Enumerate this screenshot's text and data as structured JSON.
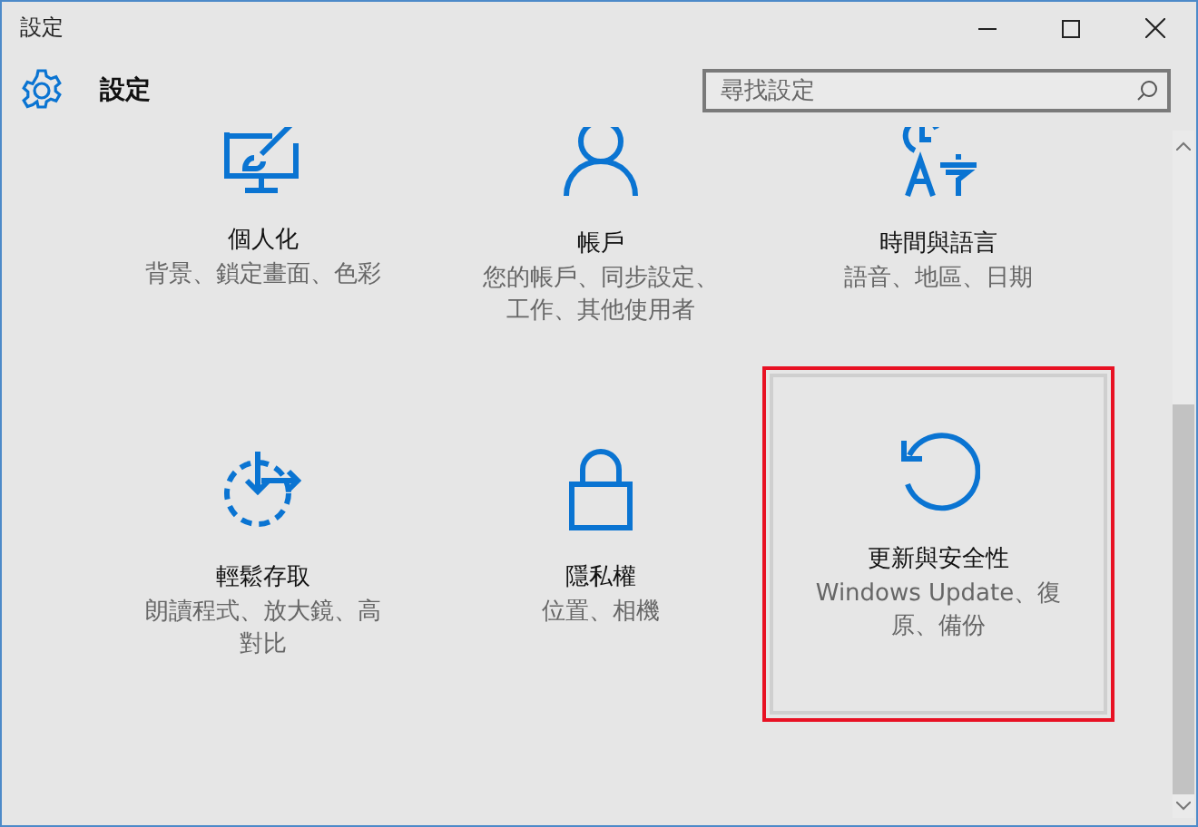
{
  "window": {
    "title": "設定"
  },
  "header": {
    "title": "設定"
  },
  "search": {
    "placeholder": "尋找設定"
  },
  "tiles": [
    {
      "kind": "personalization",
      "title": "個人化",
      "subtitle": "背景、鎖定畫面、色彩",
      "highlighted": false
    },
    {
      "kind": "accounts",
      "title": "帳戶",
      "subtitle": "您的帳戶、同步設定、工作、其他使用者",
      "highlighted": false
    },
    {
      "kind": "time-language",
      "title": "時間與語言",
      "subtitle": "語音、地區、日期",
      "highlighted": false
    },
    {
      "kind": "ease-of-access",
      "title": "輕鬆存取",
      "subtitle": "朗讀程式、放大鏡、高對比",
      "highlighted": false
    },
    {
      "kind": "privacy",
      "title": "隱私權",
      "subtitle": "位置、相機",
      "highlighted": false
    },
    {
      "kind": "update",
      "title": "更新與安全性",
      "subtitle": "Windows Update、復原、備份",
      "highlighted": true
    }
  ]
}
